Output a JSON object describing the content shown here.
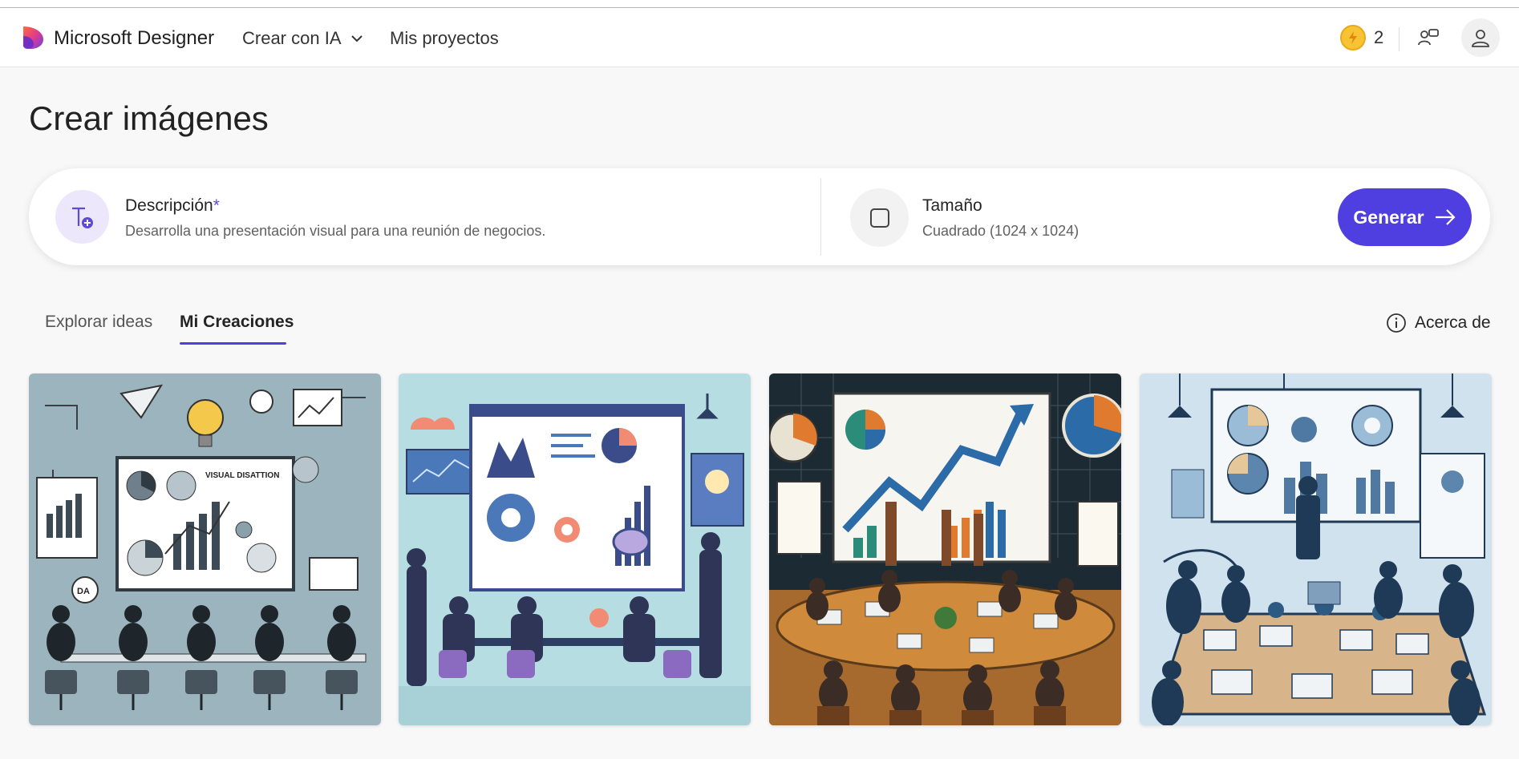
{
  "header": {
    "brand": "Microsoft Designer",
    "nav_create": "Crear con IA",
    "nav_projects": "Mis proyectos",
    "credits": "2"
  },
  "page": {
    "title": "Crear imágenes"
  },
  "prompt": {
    "description_label": "Descripción",
    "required_mark": "*",
    "description_value": "Desarrolla una presentación visual para una reunión de negocios.",
    "size_label": "Tamaño",
    "size_value": "Cuadrado (1024 x 1024)",
    "generate_label": "Generar"
  },
  "tabs": [
    {
      "label": "Explorar ideas",
      "active": false
    },
    {
      "label": "Mi Creaciones",
      "active": true
    }
  ],
  "about": {
    "label": "Acerca de"
  },
  "gallery": {
    "thumb1_caption": "VISUAL DISATTION",
    "thumb1_badge": "DA"
  },
  "colors": {
    "accent": "#4f3fe0",
    "coin": "#f7c333"
  },
  "icons": [
    "designer-logo-icon",
    "chevron-down-icon",
    "lightning-coin-icon",
    "share-icon",
    "user-icon",
    "text-add-icon",
    "square-icon",
    "arrow-right-icon",
    "info-icon"
  ]
}
